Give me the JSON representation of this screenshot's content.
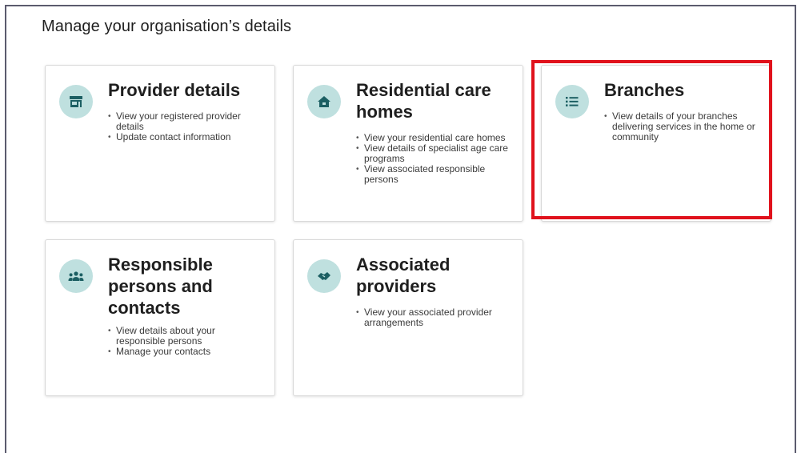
{
  "page": {
    "heading": "Manage your organisation’s details"
  },
  "cards": {
    "provider": {
      "title": "Provider details",
      "icon": "storefront-icon",
      "items": [
        "View your registered provider details",
        "Update contact information"
      ]
    },
    "residential": {
      "title": "Residential care homes",
      "icon": "home-icon",
      "items": [
        "View your residential care homes",
        "View details of specialist age care programs",
        "View associated responsible persons"
      ]
    },
    "branches": {
      "title": "Branches",
      "icon": "list-icon",
      "items": [
        "View details of your branches delivering services in the home or community"
      ]
    },
    "responsible": {
      "title": "Responsible persons and contacts",
      "icon": "group-icon",
      "items": [
        "View details about your responsible persons",
        "Manage your contacts"
      ]
    },
    "associated": {
      "title": "Associated providers",
      "icon": "handshake-icon",
      "items": [
        "View your associated provider arrangements"
      ]
    }
  },
  "colors": {
    "icon_bg": "#bfe0df",
    "icon_fg": "#1c5f63",
    "highlight": "#e0121c"
  }
}
